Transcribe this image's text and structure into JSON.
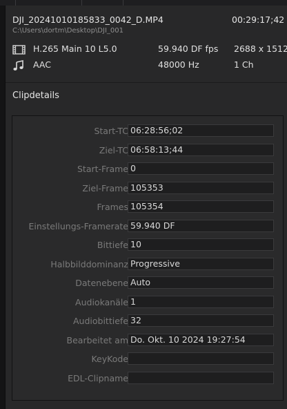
{
  "clip": {
    "file_name": "DJI_20241010185833_0042_D.MP4",
    "duration": "00:29:17;42",
    "path": "C:\\Users\\dortm\\Desktop\\DJI_001"
  },
  "video_stream": {
    "icon": "film-strip-icon",
    "codec": "H.265 Main 10 L5.0",
    "frame_rate": "59.940 DF fps",
    "resolution": "2688 x 1512"
  },
  "audio_stream": {
    "icon": "music-note-icon",
    "codec": "AAC",
    "sample_rate": "48000 Hz",
    "channels": "1 Ch"
  },
  "section": {
    "title": "Clipdetails"
  },
  "details": [
    {
      "key": "start-tc",
      "label": "Start-TC",
      "value": "06:28:56;02"
    },
    {
      "key": "ziel-tc",
      "label": "Ziel-TC",
      "value": "06:58:13;44"
    },
    {
      "key": "start-frame",
      "label": "Start-Frame",
      "value": "0"
    },
    {
      "key": "ziel-frame",
      "label": "Ziel-Frame",
      "value": "105353"
    },
    {
      "key": "frames",
      "label": "Frames",
      "value": "105354"
    },
    {
      "key": "einstellungs-framerate",
      "label": "Einstellungs-Framerate",
      "value": "59.940 DF"
    },
    {
      "key": "bittiefe",
      "label": "Bittiefe",
      "value": "10"
    },
    {
      "key": "halbbilddominanz",
      "label": "Halbbilddominanz",
      "value": "Progressive"
    },
    {
      "key": "datenebene",
      "label": "Datenebene",
      "value": "Auto"
    },
    {
      "key": "audiokanaele",
      "label": "Audiokanäle",
      "value": "1"
    },
    {
      "key": "audiobittiefe",
      "label": "Audiobittiefe",
      "value": "32"
    },
    {
      "key": "bearbeitet-am",
      "label": "Bearbeitet am",
      "value": "Do. Okt. 10 2024 19:27:54"
    },
    {
      "key": "keykode",
      "label": "KeyKode",
      "value": ""
    },
    {
      "key": "edl-clipname",
      "label": "EDL-Clipname",
      "value": ""
    }
  ],
  "colors": {
    "background": "#282829",
    "field_background": "#1e1e1f",
    "label_text": "#7a7a7a",
    "value_text": "#d8d8d8"
  }
}
